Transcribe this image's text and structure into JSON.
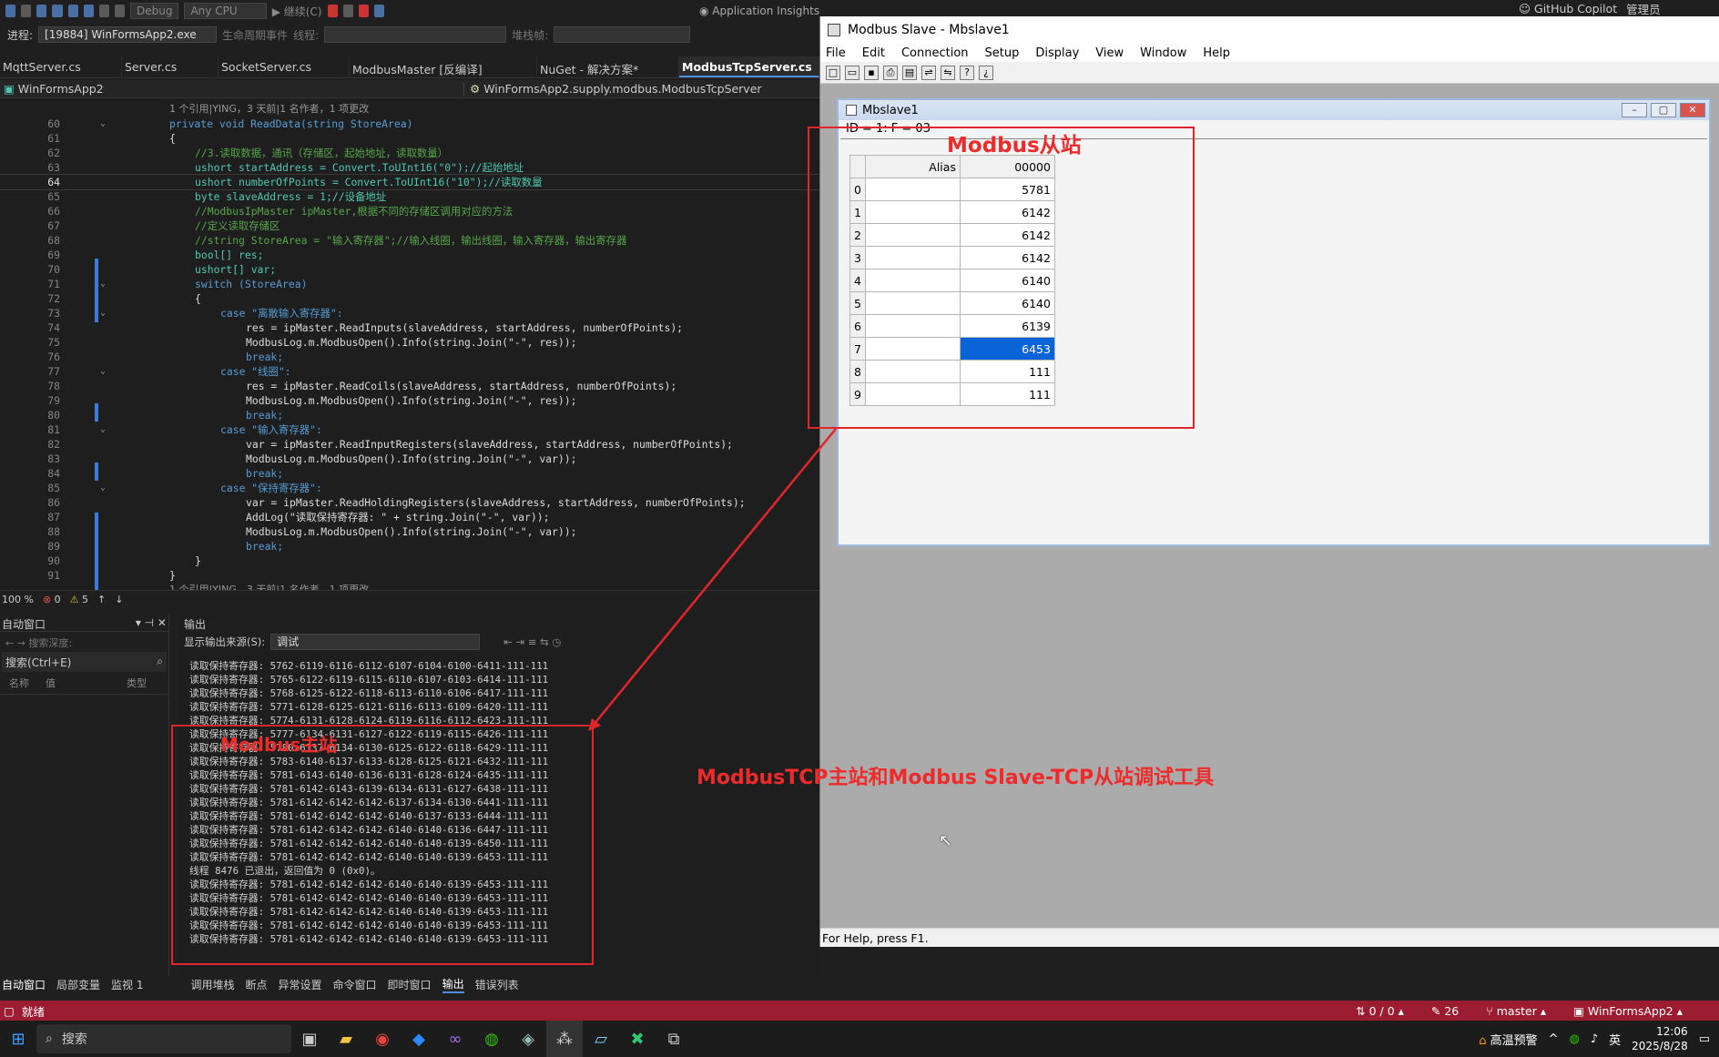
{
  "vs": {
    "toolbar1": {
      "config": "Debug",
      "platform": "Any CPU",
      "continue": "继续(C)",
      "app_insights": "Application Insights",
      "copilot": "GitHub Copilot",
      "admin": "管理员"
    },
    "toolbar2": {
      "process_label": "进程:",
      "process_value": "[19884] WinFormsApp2.exe",
      "lifecycle": "生命周期事件",
      "thread_label": "线程:",
      "stack_label": "堆栈帧:"
    },
    "tabs": [
      "MqttServer.cs",
      "Server.cs",
      "SocketServer.cs",
      "ModbusMaster [反编译]",
      "NuGet - 解决方案*",
      "ModbusTcpServer.cs"
    ],
    "nav": {
      "project": "WinFormsApp2",
      "type": "WinFormsApp2.supply.modbus.ModbusTcpServer"
    },
    "code_lines": [
      {
        "n": "",
        "t": "1 个引用|YING，3 天前|1 名作者，1 项更改",
        "k": "lens",
        "i": 0
      },
      {
        "n": "60",
        "t": "private void ReadData(string StoreArea)",
        "k": "sig",
        "i": 0
      },
      {
        "n": "61",
        "t": "{",
        "k": "plain",
        "i": 0
      },
      {
        "n": "62",
        "t": "//3.读取数据，通讯（存储区，起始地址，读取数量）",
        "k": "cm",
        "i": 1
      },
      {
        "n": "63",
        "t": "ushort startAddress = Convert.ToUInt16(\"0\");//起始地址",
        "k": "decl",
        "i": 1
      },
      {
        "n": "64",
        "t": "ushort numberOfPoints = Convert.ToUInt16(\"10\");//读取数量",
        "k": "decl",
        "i": 1
      },
      {
        "n": "65",
        "t": "byte slaveAddress = 1;//设备地址",
        "k": "decl",
        "i": 1
      },
      {
        "n": "66",
        "t": "//ModbusIpMaster ipMaster,根据不同的存储区调用对应的方法",
        "k": "cm",
        "i": 1
      },
      {
        "n": "67",
        "t": "//定义读取存储区",
        "k": "cm",
        "i": 1
      },
      {
        "n": "68",
        "t": "//string StoreArea = \"输入寄存器\";//输入线圈，输出线圈，输入寄存器，输出寄存器",
        "k": "cm",
        "i": 1
      },
      {
        "n": "69",
        "t": "bool[] res;",
        "k": "decl",
        "i": 1
      },
      {
        "n": "70",
        "t": "ushort[] var;",
        "k": "decl",
        "i": 1
      },
      {
        "n": "71",
        "t": "switch (StoreArea)",
        "k": "kw",
        "i": 1
      },
      {
        "n": "72",
        "t": "{",
        "k": "plain",
        "i": 1
      },
      {
        "n": "73",
        "t": "case \"离散输入寄存器\":",
        "k": "case",
        "i": 2
      },
      {
        "n": "74",
        "t": "res = ipMaster.ReadInputs(slaveAddress, startAddress, numberOfPoints);",
        "k": "plain",
        "i": 3
      },
      {
        "n": "75",
        "t": "ModbusLog.m.ModbusOpen().Info(string.Join(\"-\", res));",
        "k": "plain",
        "i": 3
      },
      {
        "n": "76",
        "t": "break;",
        "k": "kw",
        "i": 3
      },
      {
        "n": "77",
        "t": "case \"线圈\":",
        "k": "case",
        "i": 2
      },
      {
        "n": "78",
        "t": "res = ipMaster.ReadCoils(slaveAddress, startAddress, numberOfPoints);",
        "k": "plain",
        "i": 3
      },
      {
        "n": "79",
        "t": "ModbusLog.m.ModbusOpen().Info(string.Join(\"-\", res));",
        "k": "plain",
        "i": 3
      },
      {
        "n": "80",
        "t": "break;",
        "k": "kw",
        "i": 3
      },
      {
        "n": "81",
        "t": "case \"输入寄存器\":",
        "k": "case",
        "i": 2
      },
      {
        "n": "82",
        "t": "var = ipMaster.ReadInputRegisters(slaveAddress, startAddress, numberOfPoints);",
        "k": "plain",
        "i": 3
      },
      {
        "n": "83",
        "t": "ModbusLog.m.ModbusOpen().Info(string.Join(\"-\", var));",
        "k": "plain",
        "i": 3
      },
      {
        "n": "84",
        "t": "break;",
        "k": "kw",
        "i": 3
      },
      {
        "n": "85",
        "t": "case \"保持寄存器\":",
        "k": "case",
        "i": 2
      },
      {
        "n": "86",
        "t": "var = ipMaster.ReadHoldingRegisters(slaveAddress, startAddress, numberOfPoints);",
        "k": "plain",
        "i": 3
      },
      {
        "n": "87",
        "t": "AddLog(\"读取保持寄存器: \" + string.Join(\"-\", var));",
        "k": "plain",
        "i": 3
      },
      {
        "n": "88",
        "t": "ModbusLog.m.ModbusOpen().Info(string.Join(\"-\", var));",
        "k": "plain",
        "i": 3
      },
      {
        "n": "89",
        "t": "break;",
        "k": "kw",
        "i": 3
      },
      {
        "n": "90",
        "t": "}",
        "k": "plain",
        "i": 1
      },
      {
        "n": "91",
        "t": "}",
        "k": "plain",
        "i": 0
      },
      {
        "n": "",
        "t": "1 个引用|YING，3 天前|1 名作者，1 项更改",
        "k": "lens",
        "i": 0
      }
    ],
    "zoom": "100 %",
    "errors": "0",
    "warnings": "5",
    "auto_window": {
      "title": "自动窗口",
      "search_depth": "搜索深度:",
      "search": "搜索(Ctrl+E)",
      "cols": [
        "名称",
        "值",
        "类型"
      ]
    },
    "output": {
      "title": "输出",
      "source_label": "显示输出来源(S):",
      "source_value": "调试",
      "lines": [
        "读取保持寄存器: 5762-6119-6116-6112-6107-6104-6100-6411-111-111",
        "读取保持寄存器: 5765-6122-6119-6115-6110-6107-6103-6414-111-111",
        "读取保持寄存器: 5768-6125-6122-6118-6113-6110-6106-6417-111-111",
        "读取保持寄存器: 5771-6128-6125-6121-6116-6113-6109-6420-111-111",
        "读取保持寄存器: 5774-6131-6128-6124-6119-6116-6112-6423-111-111",
        "读取保持寄存器: 5777-6134-6131-6127-6122-6119-6115-6426-111-111",
        "读取保持寄存器: 5780-6137-6134-6130-6125-6122-6118-6429-111-111",
        "读取保持寄存器: 5783-6140-6137-6133-6128-6125-6121-6432-111-111",
        "读取保持寄存器: 5781-6143-6140-6136-6131-6128-6124-6435-111-111",
        "读取保持寄存器: 5781-6142-6143-6139-6134-6131-6127-6438-111-111",
        "读取保持寄存器: 5781-6142-6142-6142-6137-6134-6130-6441-111-111",
        "读取保持寄存器: 5781-6142-6142-6142-6140-6137-6133-6444-111-111",
        "读取保持寄存器: 5781-6142-6142-6142-6140-6140-6136-6447-111-111",
        "读取保持寄存器: 5781-6142-6142-6142-6140-6140-6139-6450-111-111",
        "读取保持寄存器: 5781-6142-6142-6142-6140-6140-6139-6453-111-111",
        "线程 8476 已退出，返回值为 0 (0x0)。",
        "读取保持寄存器: 5781-6142-6142-6142-6140-6140-6139-6453-111-111",
        "读取保持寄存器: 5781-6142-6142-6142-6140-6140-6139-6453-111-111",
        "读取保持寄存器: 5781-6142-6142-6142-6140-6140-6139-6453-111-111",
        "读取保持寄存器: 5781-6142-6142-6142-6140-6140-6139-6453-111-111",
        "读取保持寄存器: 5781-6142-6142-6142-6140-6140-6139-6453-111-111"
      ]
    },
    "bottom_tabs_left": [
      "自动窗口",
      "局部变量",
      "监视 1"
    ],
    "bottom_tabs_right": [
      "调用堆栈",
      "断点",
      "异常设置",
      "命令窗口",
      "即时窗口",
      "输出",
      "错误列表"
    ]
  },
  "modbus_slave": {
    "title": "Modbus Slave - Mbslave1",
    "menu": [
      "File",
      "Edit",
      "Connection",
      "Setup",
      "Display",
      "View",
      "Window",
      "Help"
    ],
    "child_title": "Mbslave1",
    "id_line": "ID = 1: F = 03",
    "grid_headers": [
      "Alias",
      "00000"
    ],
    "rows": [
      {
        "idx": "0",
        "val": "5781"
      },
      {
        "idx": "1",
        "val": "6142"
      },
      {
        "idx": "2",
        "val": "6142"
      },
      {
        "idx": "3",
        "val": "6142"
      },
      {
        "idx": "4",
        "val": "6140"
      },
      {
        "idx": "5",
        "val": "6140"
      },
      {
        "idx": "6",
        "val": "6139"
      },
      {
        "idx": "7",
        "val": "6453"
      },
      {
        "idx": "8",
        "val": "111"
      },
      {
        "idx": "9",
        "val": "111"
      }
    ],
    "selected_row": "7",
    "status": "For Help, press F1."
  },
  "annotations": {
    "slave_label": "Modbus从站",
    "master_label": "Modbus主站",
    "caption": "ModbusTCP主站和Modbus Slave-TCP从站调试工具"
  },
  "statusbar": {
    "ready": "就绪",
    "sync": "0 / 0",
    "edits": "26",
    "branch": "master",
    "project": "WinFormsApp2"
  },
  "taskbar": {
    "search": "搜索",
    "weather": "高温预警",
    "ime": "英",
    "time": "12:06",
    "date": "2025/8/28"
  },
  "colors": {
    "annotation": "#e0262c",
    "selection": "#0a64d8",
    "status_bar": "#9c1c32"
  }
}
